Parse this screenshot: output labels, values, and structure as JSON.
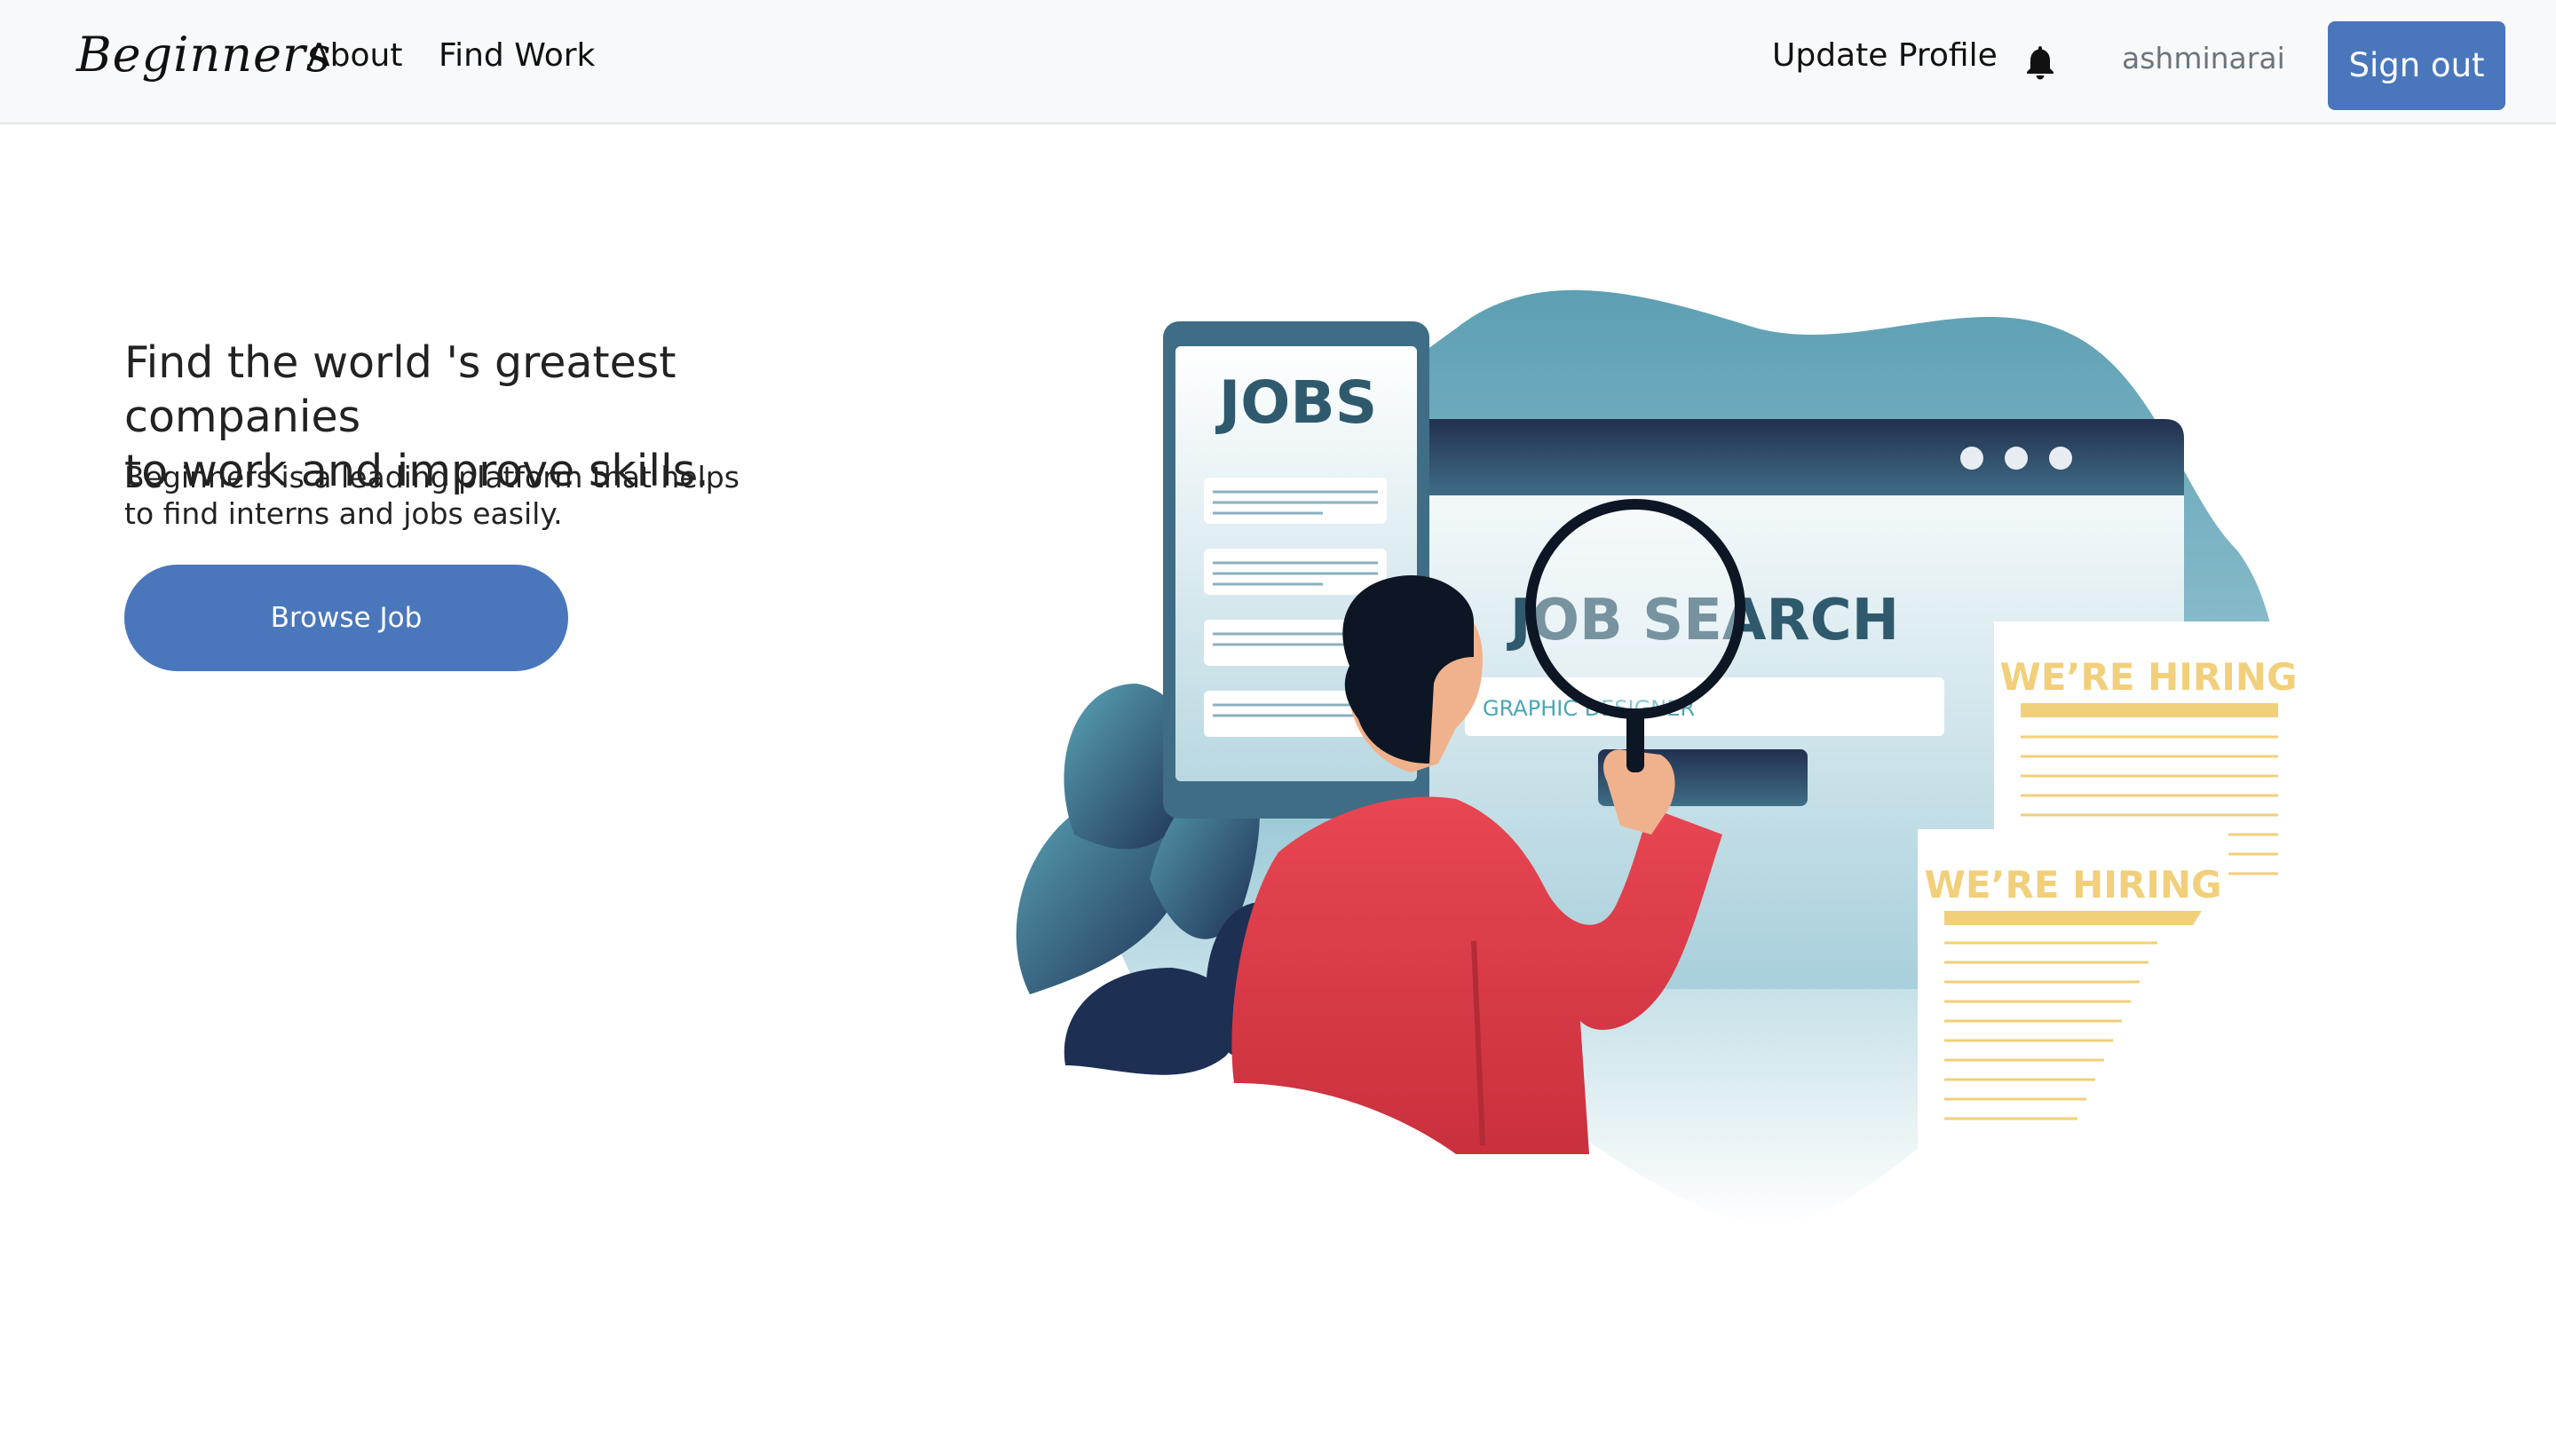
{
  "navbar": {
    "brand": "Beginners",
    "links": [
      "About",
      "Find Work"
    ],
    "update_profile": "Update Profile",
    "bell_icon": "bell-icon",
    "username": "ashminarai",
    "sign_out": "Sign out"
  },
  "hero": {
    "title_line1": "Find the world 's greatest companies",
    "title_line2": "to work and improve skills.",
    "sub_line1": "Beginners is a leading platform that helps",
    "sub_line2": "to find interns and jobs easily.",
    "cta": "Browse Job"
  },
  "illustration": {
    "jobs_label": "JOBS",
    "search_label": "JOB SEARCH",
    "search_field": "GRAPHIC DESIGNER",
    "hiring_1": "WE’RE HIRING",
    "hiring_2": "WE’RE HIRING"
  },
  "colors": {
    "primary": "#4a77bc",
    "navbar_bg": "#f8f9fa",
    "teal": "#5e9fb3",
    "navy": "#22304f",
    "red_shirt": "#e04450",
    "hiring_yellow": "#f2cf7a"
  }
}
